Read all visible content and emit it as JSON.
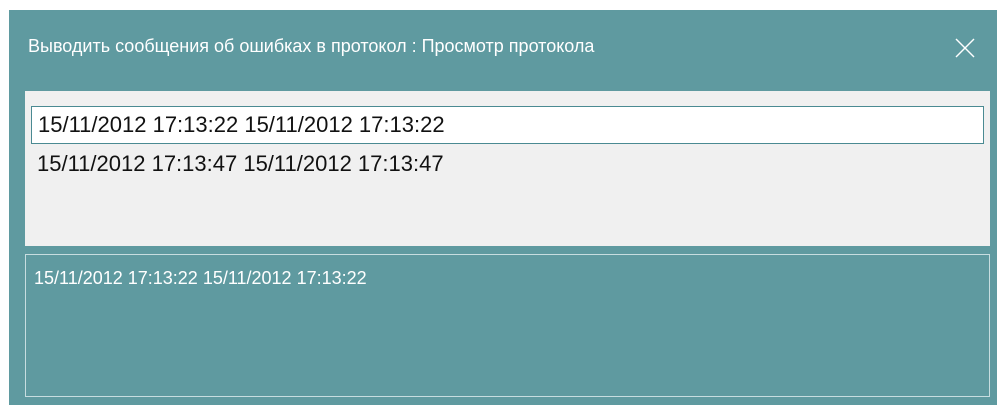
{
  "window": {
    "title": "Выводить сообщения об ошибках в протокол : Просмотр протокола",
    "close_icon": "close-icon"
  },
  "log_list": {
    "items": [
      {
        "label": "15/11/2012 17:13:22  15/11/2012 17:13:22",
        "selected": true
      },
      {
        "label": "15/11/2012 17:13:47  15/11/2012 17:13:47",
        "selected": false
      }
    ]
  },
  "detail": {
    "text": "15/11/2012 17:13:22  15/11/2012 17:13:22"
  },
  "colors": {
    "window_bg": "#5f9aa0",
    "list_bg": "#f0f0f0",
    "selection_border": "#4a8a92"
  }
}
